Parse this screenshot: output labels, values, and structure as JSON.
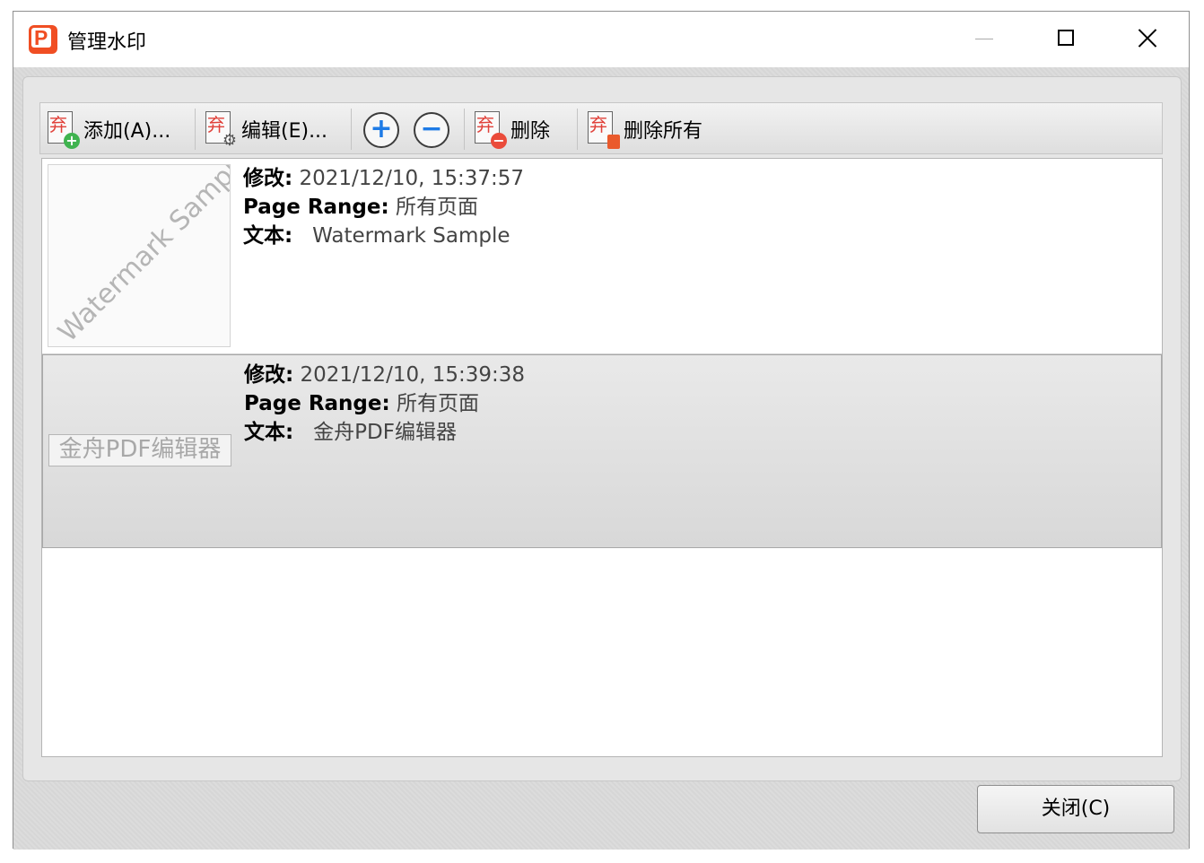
{
  "window": {
    "title": "管理水印",
    "app_icon_letter": "P"
  },
  "toolbar": {
    "add_label": "添加(A)...",
    "edit_label": "编辑(E)...",
    "move_up_symbol": "+",
    "move_down_symbol": "−",
    "delete_label": "删除",
    "delete_all_label": "删除所有",
    "icon_glyph": "弃"
  },
  "watermarks": [
    {
      "modified_label": "修改:",
      "modified_value": "2021/12/10, 15:37:57",
      "range_label": "Page Range:",
      "range_value": "所有页面",
      "text_label": "文本:",
      "text_value": "Watermark Sample",
      "thumbnail_text": "Watermark Sample",
      "selected": false
    },
    {
      "modified_label": "修改:",
      "modified_value": "2021/12/10, 15:39:38",
      "range_label": "Page Range:",
      "range_value": "所有页面",
      "text_label": "文本:",
      "text_value": "金舟PDF编辑器",
      "thumbnail_text": "金舟PDF编辑器",
      "selected": true
    }
  ],
  "footer": {
    "close_label": "关闭(C)"
  },
  "colors": {
    "accent_blue": "#1e7be6",
    "app_red": "#f04e23",
    "add_green": "#3fb34f",
    "delete_red": "#ea4b3a"
  }
}
